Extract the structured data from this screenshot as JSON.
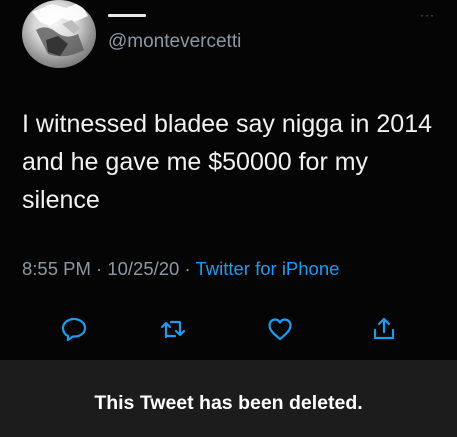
{
  "tweet": {
    "handle": "@montevercetti",
    "more_icon": "···",
    "text": "I witnessed bladee say nigga in 2014 and he gave me $50000 for my silence",
    "time_date": "8:55 PM · 10/25/20 · ",
    "source": "Twitter for iPhone"
  },
  "actions": {
    "icons": [
      "reply-icon",
      "retweet-icon",
      "like-icon",
      "share-icon"
    ]
  },
  "banner": {
    "text": "This Tweet has been deleted."
  },
  "colors": {
    "background": "#000000",
    "link": "#1d9bf0",
    "muted": "#8b98a5",
    "banner_bg": "#1c1c1c"
  }
}
